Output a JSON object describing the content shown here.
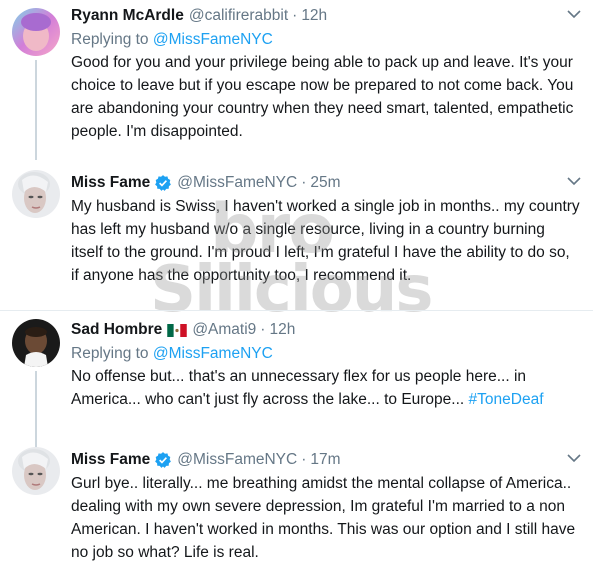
{
  "tweets": [
    {
      "name": "Ryann McArdle",
      "handle": "@califirerabbit",
      "dot": "·",
      "time": "12h",
      "reply_prefix": "Replying to",
      "reply_to": "@MissFameNYC",
      "lines": [
        "Good for you and your privilege being able to pack up and leave. It's your",
        "choice to leave but if you escape now be prepared to not come back. You",
        "are abandoning your country when they need smart, talented, empathetic",
        "people. I'm disappointed."
      ]
    },
    {
      "name": "Miss Fame",
      "handle": "@MissFameNYC",
      "dot": "·",
      "time": "25m",
      "lines": [
        "My husband is Swiss, I haven't worked a single job in months.. my country",
        "has left my husband w/o a single resource, living in a country burning",
        "itself to the ground. I'm proud I left, I'm grateful I have the ability to do so,",
        "if anyone has the opportunity too, I recommend it."
      ]
    },
    {
      "name": "Sad Hombre",
      "handle": "@Amati9",
      "dot": "·",
      "time": "12h",
      "reply_prefix": "Replying to",
      "reply_to": "@MissFameNYC",
      "lines": [
        "No offense but... that's an unnecessary flex for us people here... in",
        "America... who can't just fly across the lake... to Europe..."
      ],
      "hashtag": "#ToneDeaf"
    },
    {
      "name": "Miss Fame",
      "handle": "@MissFameNYC",
      "dot": "·",
      "time": "17m",
      "lines": [
        "Gurl bye.. literally... me breathing amidst the mental collapse of America..",
        "dealing with my own severe depression, Im grateful I'm married to a non",
        "American. I haven't worked in months. This was our option and I still have",
        "no job so what? Life is real."
      ]
    }
  ],
  "watermark": {
    "line1": "bro",
    "line2": "Silicious"
  },
  "colors": {
    "link": "#1da1f2",
    "muted": "#657786",
    "text": "#14171a",
    "verified": "#1da1f2",
    "divider": "#e6ecf0",
    "thread_line": "#ccd6dd"
  },
  "icons": {
    "verified": "verified-badge-icon",
    "flag": "mexico-flag-icon",
    "caret": "chevron-down-icon"
  }
}
